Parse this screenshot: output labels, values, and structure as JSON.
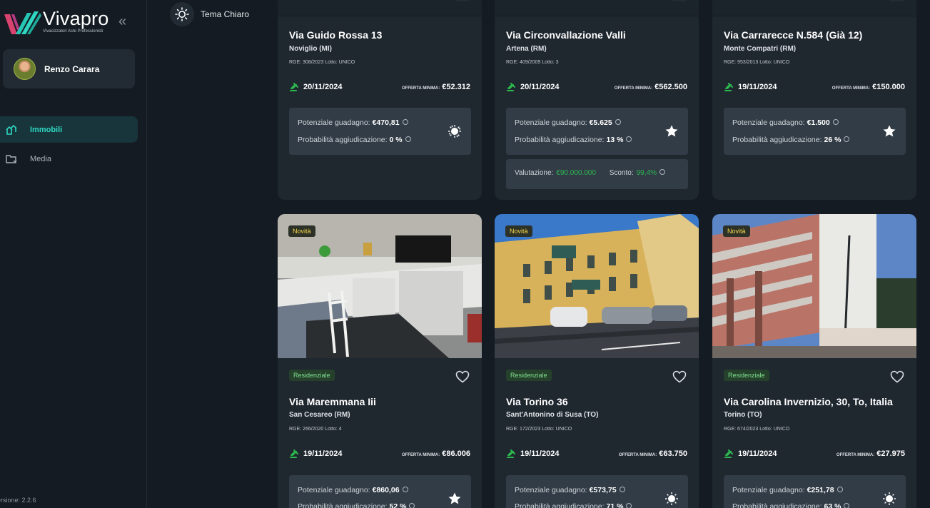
{
  "app": {
    "brand": "Vivapro",
    "brand_suffix": "pro",
    "brand_prefix": "Viva",
    "tagline": "Vivacizzatori Aste Professionisti",
    "version": "ersione: 2.2.6"
  },
  "user": {
    "name": "Renzo Carara"
  },
  "nav": [
    {
      "label": "Immobili",
      "icon": "houses-icon",
      "active": true
    },
    {
      "label": "Media",
      "icon": "folder-arrow-icon",
      "active": false
    }
  ],
  "theme": {
    "label": "Tema Chiaro",
    "icon": "sun-icon"
  },
  "colors": {
    "accent": "#2fd6c2",
    "sidebar_active": "#17353a",
    "card": "#1f272f",
    "new_badge": "#f5d84a",
    "tag": "#7fe08d",
    "green": "#2db84f"
  },
  "cards_top": [
    {
      "title": "Via Guido Rossa 13",
      "city": "Noviglio (MI)",
      "rge": "RGE: 308/2023 Lotto: UNICO",
      "date": "20/11/2024",
      "offer_label": "OFFERTA MINIMA:",
      "offer_value": "€52.312",
      "gain_label": "Potenziale guadagno:",
      "gain_value": "€470,81",
      "prob_label": "Probabilità aggiudicazione:",
      "prob_value": "0 %",
      "rating_icon": "sun-rating-icon"
    },
    {
      "title": "Via Circonvallazione Valli",
      "city": "Artena (RM)",
      "rge": "RGE: 409/2009 Lotto: 3",
      "date": "20/11/2024",
      "offer_label": "OFFERTA MINIMA:",
      "offer_value": "€562.500",
      "gain_label": "Potenziale guadagno:",
      "gain_value": "€5.625",
      "prob_label": "Probabilità aggiudicazione:",
      "prob_value": "13 %",
      "rating_icon": "star-icon",
      "valuation_label": "Valutazione:",
      "valuation_value": "€90.000.000",
      "discount_label": "Sconto:",
      "discount_value": "99,4%"
    },
    {
      "title": "Via Carrarecce N.584 (Già 12)",
      "city": "Monte Compatri (RM)",
      "rge": "RGE: 953/2013 Lotto: UNICO",
      "date": "19/11/2024",
      "offer_label": "OFFERTA MINIMA:",
      "offer_value": "€150.000",
      "gain_label": "Potenziale guadagno:",
      "gain_value": "€1.500",
      "prob_label": "Probabilità aggiudicazione:",
      "prob_value": "26 %",
      "rating_icon": "star-icon"
    }
  ],
  "cards_bottom": [
    {
      "badge": "Novità",
      "tag": "Residenziale",
      "title": "Via Maremmana Iii",
      "city": "San Cesareo (RM)",
      "rge": "RGE: 266/2020 Lotto: 4",
      "date": "19/11/2024",
      "offer_label": "OFFERTA MINIMA:",
      "offer_value": "€86.006",
      "gain_label": "Potenziale guadagno:",
      "gain_value": "€860,06",
      "prob_label": "Probabilità aggiudicazione:",
      "prob_value": "52 %",
      "rating_icon": "star-icon"
    },
    {
      "badge": "Novità",
      "tag": "Residenziale",
      "title": "Via Torino 36",
      "city": "Sant'Antonino di Susa (TO)",
      "rge": "RGE: 172/2023 Lotto: UNICO",
      "date": "19/11/2024",
      "offer_label": "OFFERTA MINIMA:",
      "offer_value": "€63.750",
      "gain_label": "Potenziale guadagno:",
      "gain_value": "€573,75",
      "prob_label": "Probabilità aggiudicazione:",
      "prob_value": "71 %",
      "rating_icon": "sun-rating-icon"
    },
    {
      "badge": "Novità",
      "tag": "Residenziale",
      "title": "Via Carolina Invernizio, 30, To, Italia",
      "city": "Torino (TO)",
      "rge": "RGE: 674/2023 Lotto: UNICO",
      "date": "19/11/2024",
      "offer_label": "OFFERTA MINIMA:",
      "offer_value": "€27.975",
      "gain_label": "Potenziale guadagno:",
      "gain_value": "€251,78",
      "prob_label": "Probabilità aggiudicazione:",
      "prob_value": "63 %",
      "rating_icon": "sun-rating-icon"
    }
  ]
}
